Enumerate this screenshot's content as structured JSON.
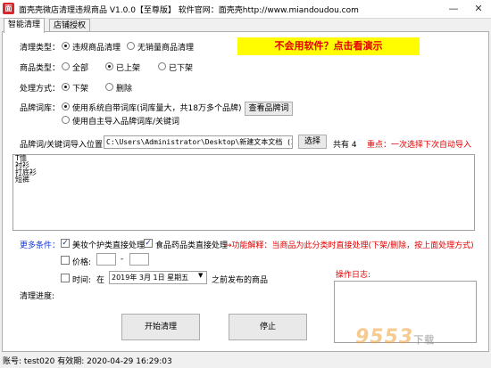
{
  "titlebar": {
    "icon_glyph": "面",
    "title": "面壳壳微店清理违规商品 V1.0.0【至尊版】   软件官网：面壳壳http://www.miandoudou.com",
    "minimize": "—",
    "close": "✕"
  },
  "tabs": [
    {
      "label": "智能清理",
      "active": true
    },
    {
      "label": "店铺授权",
      "active": false
    }
  ],
  "clean_type": {
    "label": "清理类型：",
    "options": [
      {
        "label": "违规商品清理",
        "selected": true
      },
      {
        "label": "无销量商品清理",
        "selected": false
      }
    ]
  },
  "demo_banner": "不会用软件？点击看演示",
  "product_type": {
    "label": "商品类型：",
    "options": [
      {
        "label": "全部",
        "selected": false
      },
      {
        "label": "已上架",
        "selected": true
      },
      {
        "label": "已下架",
        "selected": false
      }
    ]
  },
  "handling": {
    "label": "处理方式：",
    "options": [
      {
        "label": "下架",
        "selected": true
      },
      {
        "label": "删除",
        "selected": false
      }
    ]
  },
  "brand_lexicon": {
    "label": "品牌词库：",
    "options": [
      {
        "label": "使用系统自带词库(词库量大，共18万多个品牌)",
        "selected": true
      },
      {
        "label": "使用自主导入品牌词库/关键词",
        "selected": false
      }
    ],
    "view_button": "查看品牌词"
  },
  "import": {
    "label": "品牌词/关键词导入位置：",
    "path": "C:\\Users\\Administrator\\Desktop\\新建文本文档 (2).txt",
    "select_button": "选择",
    "count_text": "共有 4",
    "note": "重点：一次选择下次自动导入"
  },
  "keywords": [
    "T恤",
    "衬衫",
    "打底衫",
    "短裤"
  ],
  "more_conditions": {
    "label": "更多条件：",
    "checks": [
      {
        "label": "美妆个护类直接处理",
        "checked": true
      },
      {
        "label": "食品药品类直接处理",
        "checked": true
      }
    ],
    "explain": "→功能解释：当商品为此分类时直接处理(下架/删除，按上面处理方式)"
  },
  "price": {
    "label": "价格:",
    "checked": false,
    "dash": "-"
  },
  "time": {
    "label": "时间:",
    "checked": false,
    "prefix": "在",
    "date": "2019年 3月 1日 星期五",
    "suffix": "之前发布的商品"
  },
  "progress_label": "清理进度:",
  "log_label": "操作日志:",
  "buttons": {
    "start": "开始清理",
    "stop": "停止"
  },
  "statusbar": "账号: test020   有效期: 2020-04-29 16:29:03",
  "watermark": {
    "main": "9553",
    "sub": "下载"
  },
  "colors": {
    "note_red": "#e00000",
    "link_blue": "#1a3ad0",
    "banner_yellow": "#fffd00"
  }
}
